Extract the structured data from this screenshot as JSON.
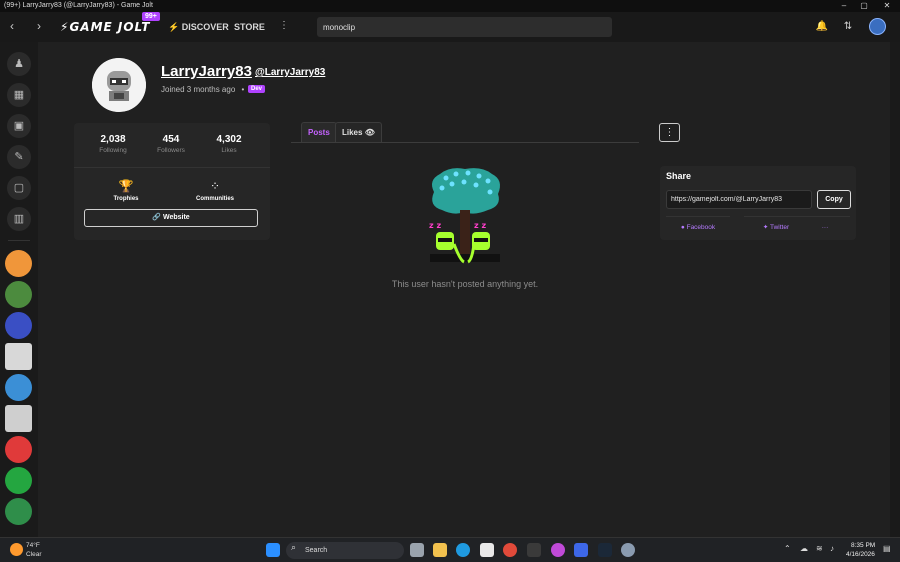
{
  "window": {
    "title": "(99+) LarryJarry83 (@LarryJarry83) - Game Jolt",
    "minimize": "–",
    "maximize": "▢",
    "close": "✕"
  },
  "nav": {
    "back": "‹",
    "forward": "›",
    "logo": "GAME JOLT",
    "notif_count": "99+",
    "discover": "DISCOVER",
    "store": "STORE",
    "more": "⋮",
    "search_value": "monoclip"
  },
  "profile": {
    "display_name": "LarryJarry83",
    "handle": "@LarryJarry83",
    "joined": "Joined 3 months ago",
    "dot": "•",
    "badge": "Dev"
  },
  "stats": [
    {
      "value": "2,038",
      "label": "Following"
    },
    {
      "value": "454",
      "label": "Followers"
    },
    {
      "value": "4,302",
      "label": "Likes"
    }
  ],
  "links": {
    "trophies": "Trophies",
    "communities": "Communities",
    "website": "Website"
  },
  "tabs": {
    "posts": "Posts",
    "likes": "Likes"
  },
  "empty_message": "This user hasn't posted anything yet.",
  "share": {
    "title": "Share",
    "url": "https://gamejolt.com/@LarryJarry83",
    "copy": "Copy",
    "facebook": "Facebook",
    "twitter": "Twitter",
    "more": "···"
  },
  "taskbar": {
    "temp": "74°F",
    "condition": "Clear",
    "search": "Search",
    "time": "8:35 PM",
    "date": "4/16/2026"
  },
  "colors": {
    "accent": "#b042ff",
    "posts_tab": "#c563ff",
    "tree_canopy": "#2aa39a",
    "tree_dots": "#6de2ff",
    "creature": "#a6ff2e",
    "zzz": "#ff3ecb"
  }
}
